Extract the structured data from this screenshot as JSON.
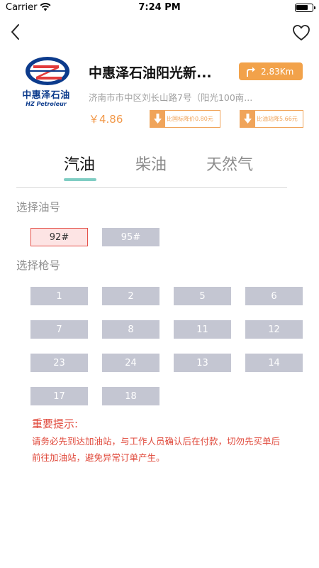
{
  "status_bar": {
    "carrier": "Carrier",
    "time": "7:24 PM",
    "battery_level": 0.75
  },
  "station": {
    "logo_cn": "中惠泽石油",
    "logo_en": "HZ Petroleur",
    "name": "中惠泽石油阳光新...",
    "distance": "2.83Km",
    "address": "济南市市中区刘长山路7号（阳光100南...",
    "price": "￥4.86",
    "discounts": [
      "比国标降价0.80元",
      "比油站降5.66元"
    ]
  },
  "tabs": [
    {
      "label": "汽油",
      "active": true
    },
    {
      "label": "柴油",
      "active": false
    },
    {
      "label": "天然气",
      "active": false
    }
  ],
  "oil_section": {
    "label": "选择油号",
    "options": [
      {
        "label": "92#",
        "selected": true
      },
      {
        "label": "95#",
        "selected": false
      }
    ]
  },
  "gun_section": {
    "label": "选择枪号",
    "options": [
      "1",
      "2",
      "5",
      "6",
      "7",
      "8",
      "11",
      "12",
      "23",
      "24",
      "13",
      "14",
      "17",
      "18"
    ]
  },
  "notice": {
    "title": "重要提示:",
    "body": "请务必先到达加油站，与工作人员确认后在付款，切勿先买单后前往加油站，避免异常订单产生。"
  },
  "colors": {
    "accent_orange": "#f2a24a",
    "tab_indicator": "#7fcdc3",
    "chip_gray": "#c4c6d2",
    "warning_red": "#e04a3c"
  }
}
